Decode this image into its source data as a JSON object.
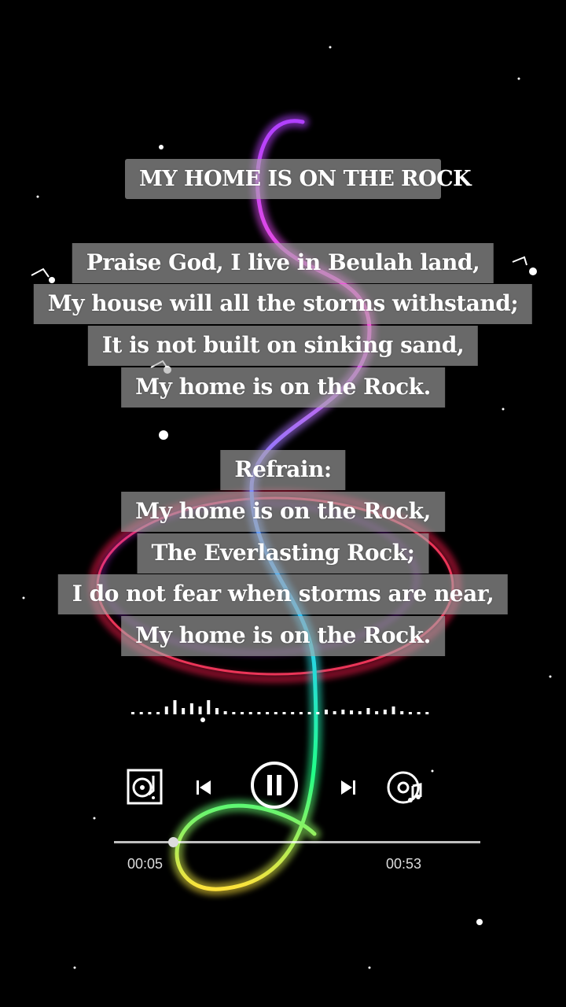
{
  "song": {
    "title": "MY HOME IS ON THE ROCK"
  },
  "verse": [
    "Praise God, I live in Beulah land,",
    "My house will all the storms withstand;",
    "It is not built on sinking sand,",
    "My home is on the Rock."
  ],
  "refrain": {
    "heading": "Refrain:",
    "lines": [
      "My home is on the Rock,",
      "The Everlasting Rock;",
      "I do not fear when storms are near,",
      "My home is on the Rock."
    ]
  },
  "player": {
    "elapsed": "00:05",
    "duration": "00:53",
    "progress_fraction": 0.16,
    "state": "playing",
    "icons": [
      "turntable-icon",
      "previous-icon",
      "pause-icon",
      "next-icon",
      "music-disc-icon"
    ]
  },
  "colors": {
    "text_box": "#aaaaaa",
    "text": "#ffffff",
    "background": "#000000"
  }
}
